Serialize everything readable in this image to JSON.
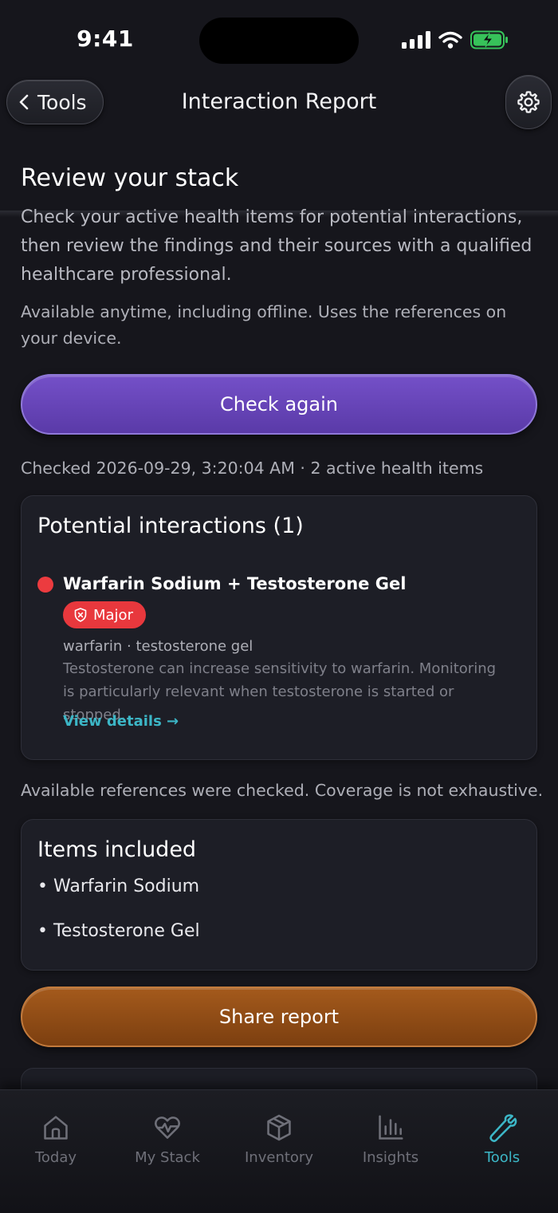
{
  "status_bar": {
    "time": "9:41"
  },
  "nav": {
    "back_label": "Tools",
    "title": "Interaction Report"
  },
  "review": {
    "title": "Review your stack",
    "intro": "Check your active health items for potential interactions, then review the findings and their sources with a qualified healthcare professional.",
    "offline_note": "Available anytime, including offline. Uses the references on your device.",
    "check_again_label": "Check again",
    "checked_meta": "Checked 2026-09-29, 3:20:04 AM · 2 active health items"
  },
  "interactions": {
    "title": "Potential interactions (1)",
    "items": [
      {
        "name": "Warfarin Sodium + Testosterone Gel",
        "severity": "Major",
        "severity_color": "#e8383d",
        "ingredients": "warfarin · testosterone gel",
        "description": "Testosterone can increase sensitivity to warfarin. Monitoring is particularly relevant when testosterone is started or stopped.",
        "link_label": "View details →"
      }
    ]
  },
  "coverage_note": "Available references were checked. Coverage is not exhaustive.",
  "items_included": {
    "title": "Items included",
    "items": [
      "Warfarin Sodium",
      "Testosterone Gel"
    ]
  },
  "share_label": "Share report",
  "tab_bar": {
    "active": "Tools",
    "accent_color": "#3cb6c6",
    "tabs": [
      {
        "label": "Today",
        "icon": "home-icon"
      },
      {
        "label": "My Stack",
        "icon": "heart-pulse-icon"
      },
      {
        "label": "Inventory",
        "icon": "box-icon"
      },
      {
        "label": "Insights",
        "icon": "bar-chart-icon"
      },
      {
        "label": "Tools",
        "icon": "wrench-icon"
      }
    ]
  }
}
